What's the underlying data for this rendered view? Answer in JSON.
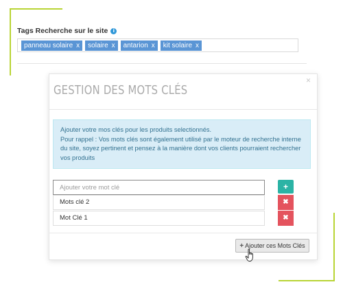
{
  "tags_field": {
    "label": "Tags Recherche sur le site",
    "info_icon": "i",
    "remove_symbol": "x",
    "tags": [
      "panneau solaire",
      "solaire",
      "antarion",
      "kit solaire"
    ]
  },
  "modal": {
    "title": "GESTION DES MOTS CLÉS",
    "close_symbol": "×",
    "alert": {
      "line1": "Ajouter votre mos clés pour les produits selectionnés.",
      "line2": "Pour rappel : Vos mots clés sont également utilisé par le moteur de recherche interne du site, soyez pertinent et pensez à la manière dont vos clients pourraient rechercher vos produits"
    },
    "keyword_input": {
      "placeholder": "Ajouter votre mot clé",
      "value": ""
    },
    "keywords": [
      "Mots clé 2",
      "Mot Clé 1"
    ],
    "add_symbol": "+",
    "delete_symbol": "✖",
    "submit_icon": "+",
    "submit_label": "Ajouter ces Mots Clés"
  },
  "colors": {
    "accent_green": "#b8d433",
    "tag_blue": "#5a95d5",
    "add_teal": "#2bb3a5",
    "delete_red": "#e4535e",
    "alert_bg": "#d9edf7"
  }
}
